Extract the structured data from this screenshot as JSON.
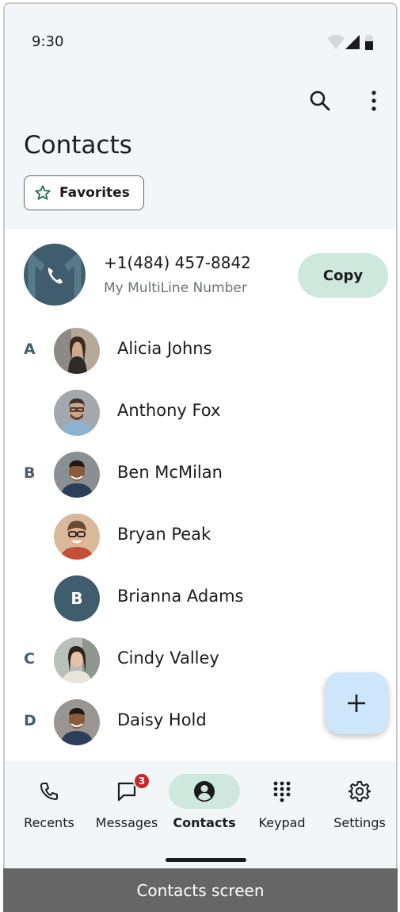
{
  "status_bar": {
    "time": "9:30"
  },
  "header": {
    "title": "Contacts",
    "favorites_label": "Favorites"
  },
  "multiline": {
    "number": "+1(484) 457-8842",
    "subtitle": "My MultiLine Number",
    "copy_label": "Copy"
  },
  "contacts": [
    {
      "letter": "A",
      "name": "Alicia Johns",
      "avatar": "photo"
    },
    {
      "letter": "",
      "name": "Anthony Fox",
      "avatar": "photo"
    },
    {
      "letter": "B",
      "name": "Ben McMilan",
      "avatar": "photo"
    },
    {
      "letter": "",
      "name": "Bryan Peak",
      "avatar": "photo"
    },
    {
      "letter": "",
      "name": "Brianna Adams",
      "avatar": "B"
    },
    {
      "letter": "C",
      "name": "Cindy Valley",
      "avatar": "photo"
    },
    {
      "letter": "D",
      "name": "Daisy Hold",
      "avatar": "photo"
    }
  ],
  "bottom_nav": [
    {
      "label": "Recents",
      "icon": "phone-icon"
    },
    {
      "label": "Messages",
      "icon": "message-icon",
      "badge": "3"
    },
    {
      "label": "Contacts",
      "icon": "person-circle-icon",
      "active": true
    },
    {
      "label": "Keypad",
      "icon": "dialpad-icon"
    },
    {
      "label": "Settings",
      "icon": "gear-icon"
    }
  ],
  "caption": "Contacts screen",
  "colors": {
    "accent": "#cfe8de",
    "primary": "#3f5d6c",
    "fab": "#cde6fb",
    "badge": "#c62828"
  }
}
